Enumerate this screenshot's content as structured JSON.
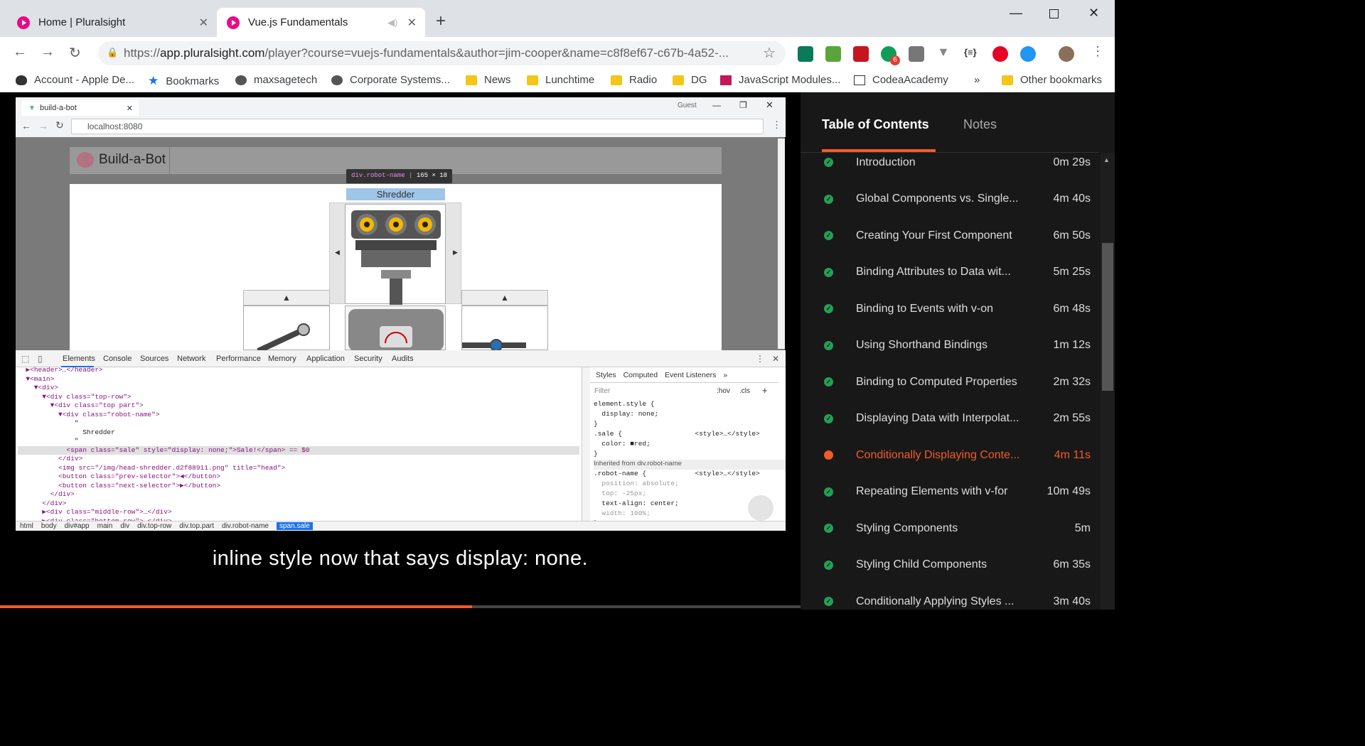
{
  "browser": {
    "tabs": [
      {
        "title": "Home | Pluralsight"
      },
      {
        "title": "Vue.js Fundamentals"
      }
    ],
    "url_prefix": "https://",
    "url_host": "app.pluralsight.com",
    "url_path": "/player?course=vuejs-fundamentals&author=jim-cooper&name=c8f8ef67-c67b-4a52-...",
    "extension_badge": "6",
    "bookmarks": [
      {
        "label": "Account - Apple De...",
        "icon": "apple-icon"
      },
      {
        "label": "Bookmarks",
        "icon": "star-icon"
      },
      {
        "label": "maxsagetech",
        "icon": "globe-icon"
      },
      {
        "label": "Corporate Systems...",
        "icon": "globe-icon"
      },
      {
        "label": "News",
        "icon": "folder-icon"
      },
      {
        "label": "Lunchtime",
        "icon": "folder-icon"
      },
      {
        "label": "Radio",
        "icon": "folder-icon"
      },
      {
        "label": "DG",
        "icon": "folder-icon"
      },
      {
        "label": "JavaScript Modules...",
        "icon": "site-icon"
      },
      {
        "label": "CodeaAcademy",
        "icon": "site-icon"
      },
      {
        "label": "»",
        "icon": ""
      },
      {
        "label": "Other bookmarks",
        "icon": "folder-icon"
      }
    ]
  },
  "video": {
    "inner_tab": "build-a-bot",
    "inner_user": "Guest",
    "inner_url": "localhost:8080",
    "app_title": "Build-a-Bot",
    "tooltip_tag": "div.robot-name",
    "tooltip_size": "165 × 18",
    "robot_name": "Shredder",
    "up_arrow": "▲",
    "left_arrow": "◀",
    "right_arrow": "▶",
    "devtools": {
      "tabs": [
        "Elements",
        "Console",
        "Sources",
        "Network",
        "Performance",
        "Memory",
        "Application",
        "Security",
        "Audits"
      ],
      "dom_lines": [
        {
          "indent": "  ",
          "text": "▶<header>…</header>"
        },
        {
          "indent": "  ",
          "text": "▼<main>"
        },
        {
          "indent": "    ",
          "text": "▼<div>"
        },
        {
          "indent": "      ",
          "text": "▼<div class=\"top-row\">"
        },
        {
          "indent": "        ",
          "text": "▼<div class=\"top part\">"
        },
        {
          "indent": "          ",
          "text": "▼<div class=\"robot-name\">"
        },
        {
          "indent": "              ",
          "text": "\""
        },
        {
          "indent": "                ",
          "text": "Shredder"
        },
        {
          "indent": "              ",
          "text": "\""
        },
        {
          "indent": "            ",
          "text": "<span class=\"sale\" style=\"display: none;\">Sale!</span> == $0"
        },
        {
          "indent": "          ",
          "text": "</div>"
        },
        {
          "indent": "          ",
          "text": "<img src=\"/img/head-shredder.d2f88911.png\" title=\"head\">"
        },
        {
          "indent": "          ",
          "text": "<button class=\"prev-selector\">◀</button>"
        },
        {
          "indent": "          ",
          "text": "<button class=\"next-selector\">▶</button>"
        },
        {
          "indent": "        ",
          "text": "</div>"
        },
        {
          "indent": "      ",
          "text": "</div>"
        },
        {
          "indent": "      ",
          "text": "▶<div class=\"middle-row\">…</div>"
        },
        {
          "indent": "      ",
          "text": "▶<div class=\"bottom-row\">…</div>"
        }
      ],
      "styles_tabs": [
        "Styles",
        "Computed",
        "Event Listeners",
        "»"
      ],
      "filter_placeholder": "Filter",
      "filter_hov": ":hov",
      "filter_cls": ".cls",
      "style_lines": [
        "element.style {",
        "  display: none;",
        "}",
        ".sale {                  <style>…</style>",
        "  color: ■red;",
        "}",
        "Inherited from div.robot-name",
        ".robot-name {            <style>…</style>",
        "  position: absolute;",
        "  top: -25px;",
        "  text-align: center;",
        "  width: 100%;",
        "}"
      ],
      "breadcrumbs": [
        "html",
        "body",
        "div#app",
        "main",
        "div",
        "div.top-row",
        "div.top.part",
        "div.robot-name",
        "span.sale"
      ]
    },
    "caption": "inline style now that says display: none.",
    "progress_fraction": 0.59
  },
  "sidebar": {
    "tabs": [
      "Table of Contents",
      "Notes"
    ],
    "items": [
      {
        "title": "Introduction",
        "duration": "0m 29s",
        "state": "done"
      },
      {
        "title": "Global Components vs. Single...",
        "duration": "4m 40s",
        "state": "done"
      },
      {
        "title": "Creating Your First Component",
        "duration": "6m 50s",
        "state": "done"
      },
      {
        "title": "Binding Attributes to Data wit...",
        "duration": "5m 25s",
        "state": "done"
      },
      {
        "title": "Binding to Events with v-on",
        "duration": "6m 48s",
        "state": "done"
      },
      {
        "title": "Using Shorthand Bindings",
        "duration": "1m 12s",
        "state": "done"
      },
      {
        "title": "Binding to Computed Properties",
        "duration": "2m 32s",
        "state": "done"
      },
      {
        "title": "Displaying Data with Interpolat...",
        "duration": "2m 55s",
        "state": "done"
      },
      {
        "title": "Conditionally Displaying Conte...",
        "duration": "4m 11s",
        "state": "active"
      },
      {
        "title": "Repeating Elements with v-for",
        "duration": "10m 49s",
        "state": "done"
      },
      {
        "title": "Styling Components",
        "duration": "5m",
        "state": "done"
      },
      {
        "title": "Styling Child Components",
        "duration": "6m 35s",
        "state": "done"
      },
      {
        "title": "Conditionally Applying Styles ...",
        "duration": "3m 40s",
        "state": "done"
      }
    ]
  }
}
